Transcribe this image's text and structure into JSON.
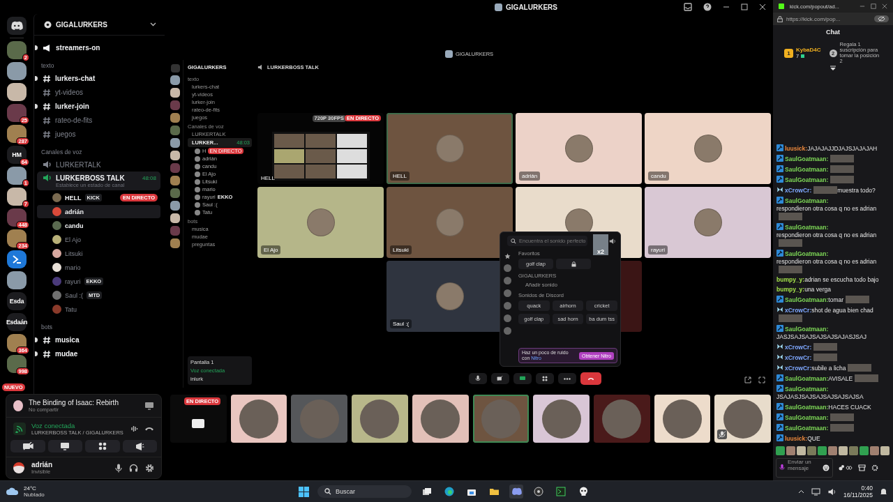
{
  "titlebar": {
    "title": "GIGALURKERS"
  },
  "servers": [
    {
      "kind": "image",
      "badge": "2"
    },
    {
      "kind": "image"
    },
    {
      "kind": "image"
    },
    {
      "kind": "image",
      "badge": "25"
    },
    {
      "kind": "image",
      "badge": "287"
    },
    {
      "kind": "text",
      "label": "HM",
      "badge": "64"
    },
    {
      "kind": "image",
      "badge": "1"
    },
    {
      "kind": "image",
      "badge": "7"
    },
    {
      "kind": "image",
      "badge": "448"
    },
    {
      "kind": "image",
      "badge": "234"
    },
    {
      "kind": "app"
    },
    {
      "kind": "image"
    },
    {
      "kind": "text",
      "label": "Esda"
    },
    {
      "kind": "text",
      "label": "Esdaán"
    },
    {
      "kind": "image",
      "badge": "364"
    },
    {
      "kind": "image",
      "badge": "998"
    }
  ],
  "new_pill": "NUEVO",
  "sidebar": {
    "title": "GIGALURKERS",
    "top_channel": {
      "name": "streamers-on",
      "unread": true
    },
    "text_category": {
      "name": "texto",
      "channels": [
        {
          "name": "lurkers-chat",
          "unread": true
        },
        {
          "name": "yt-videos",
          "unread": false
        },
        {
          "name": "lurker-join",
          "unread": true
        },
        {
          "name": "rateo-de-fits",
          "unread": false
        },
        {
          "name": "juegos",
          "unread": false
        }
      ]
    },
    "voice_category": {
      "name": "Canales de voz",
      "channels": [
        {
          "name": "LURKERTALK",
          "connected": false
        },
        {
          "name": "LURKERBOSS TALK",
          "connected": true,
          "timer": "48:08",
          "status": "Establece un estado de canal",
          "members": [
            {
              "name": "HELL",
              "tag": "KICK",
              "live": "EN DIRECTO",
              "bright": true,
              "hovered": false,
              "color": "#7a6a50"
            },
            {
              "name": "adrián",
              "bright": true,
              "hovered": true,
              "color": "#d94a3a"
            },
            {
              "name": "candu",
              "bright": true,
              "hovered": false,
              "color": "#5a6a50"
            },
            {
              "name": "El Ajo",
              "bright": false,
              "hovered": false,
              "color": "#b8b078"
            },
            {
              "name": "Litsuki",
              "bright": false,
              "hovered": false,
              "color": "#d8a8a0"
            },
            {
              "name": "mario",
              "bright": false,
              "hovered": false,
              "color": "#e8e0d8"
            },
            {
              "name": "rayuri",
              "tag": "EKKO",
              "bright": false,
              "hovered": false,
              "color": "#4a3a7a"
            },
            {
              "name": "Saul :(",
              "tag": "MTD",
              "bright": false,
              "hovered": false,
              "color": "#707070"
            },
            {
              "name": "Tatu",
              "bright": false,
              "hovered": false,
              "color": "#8a3a2a"
            }
          ]
        }
      ]
    },
    "bots_category": {
      "name": "bots",
      "channels": [
        {
          "name": "musica",
          "unread": true
        },
        {
          "name": "mudae",
          "unread": true
        }
      ]
    }
  },
  "panel": {
    "activity": {
      "title": "The Binding of Isaac: Rebirth",
      "subtitle": "No compartir"
    },
    "voice": {
      "status": "Voz conectada",
      "channel": "LURKERBOSS TALK / GIGALURKERS"
    },
    "user": {
      "name": "adrián",
      "status": "Invisible"
    }
  },
  "stream": {
    "title": "GIGALURKERS",
    "channel": "LURKERBOSS TALK",
    "inner_sidebar": {
      "title": "GIGALURKERS",
      "category": "texto",
      "channels": [
        "lurkers-chat",
        "yt-videos",
        "lurker-join",
        "rateo-de-fits",
        "juegos"
      ],
      "voice_category": "Canales de voz",
      "voice_channels": [
        "LURKERTALK",
        "LURKER..."
      ],
      "timer": "48:03",
      "members": [
        {
          "name": "H",
          "live": "EN DIRECTO"
        },
        {
          "name": "adrián"
        },
        {
          "name": "candu"
        },
        {
          "name": "El Ajo"
        },
        {
          "name": "Litsuki"
        },
        {
          "name": "mario"
        },
        {
          "name": "rayuri",
          "tag": "EKKO"
        },
        {
          "name": "Saul :("
        },
        {
          "name": "Tatu"
        }
      ],
      "bots_category": "bots",
      "bots_channels": [
        "musica",
        "mudae",
        "preguntas"
      ],
      "screen": "Pantalla 1",
      "voice_status": "Voz conectada",
      "user": "inlurk"
    },
    "tiles": [
      {
        "kind": "stream",
        "name": "HELL",
        "quality": "720P 30FPS",
        "live": "EN DIRECTO"
      },
      {
        "kind": "user",
        "name": "HELL",
        "color": "#6e5440",
        "speaking": true
      },
      {
        "kind": "user",
        "name": "adrián",
        "color": "#ecd2c8",
        "speaking": false
      },
      {
        "kind": "user",
        "name": "candu",
        "color": "#eed5c6",
        "speaking": false
      },
      {
        "kind": "user",
        "name": "El Ajo",
        "color": "#b5b689",
        "speaking": false
      },
      {
        "kind": "user",
        "name": "Litsuki",
        "color": "#6e5440",
        "speaking": false
      },
      {
        "kind": "user",
        "color": "#e9dccb",
        "speaking": false
      },
      {
        "kind": "user",
        "name": "rayuri",
        "color": "#d9c8d4",
        "speaking": false
      },
      {
        "kind": "empty"
      },
      {
        "kind": "user",
        "name": "Saul :(",
        "color": "#2f343f",
        "speaking": false
      },
      {
        "kind": "user",
        "color": "#3b1515",
        "speaking": false
      },
      {
        "kind": "empty"
      }
    ],
    "soundboard": {
      "placeholder": "Encuentra el sonido perfecto",
      "sticker_count": "x2",
      "favorites": {
        "title": "Favoritos",
        "sounds": [
          {
            "name": "golf clap",
            "locked": false
          },
          {
            "locked": true
          }
        ]
      },
      "server": {
        "title": "GIGALURKERS",
        "add": "Añadir sonido"
      },
      "discord": {
        "title": "Sonidos de Discord",
        "sounds": [
          {
            "name": "quack",
            "locked": false
          },
          {
            "name": "airhorn",
            "locked": false
          },
          {
            "name": "cricket",
            "locked": false
          },
          {
            "name": "golf clap",
            "locked": false
          },
          {
            "name": "sad horn",
            "locked": false
          },
          {
            "name": "ba dum tss",
            "locked": false
          }
        ]
      },
      "promo": "Haz un poco de ruido con",
      "promo_link": "Nitro",
      "button": "Obtener Nitro"
    }
  },
  "strip": [
    {
      "kind": "stream",
      "live": "EN DIRECTO"
    },
    {
      "kind": "user",
      "color": "#e9c6c0",
      "speaking": false,
      "muted": false
    },
    {
      "kind": "user",
      "color": "#55575a",
      "speaking": false,
      "muted": false
    },
    {
      "kind": "user",
      "color": "#b8b78a",
      "speaking": false,
      "muted": false
    },
    {
      "kind": "user",
      "color": "#e2c0b8",
      "speaking": false,
      "muted": false
    },
    {
      "kind": "user",
      "color": "#6e5440",
      "speaking": true,
      "muted": false
    },
    {
      "kind": "user",
      "color": "#d9c6d6",
      "speaking": false,
      "muted": false
    },
    {
      "kind": "user",
      "color": "#4a1a1a",
      "speaking": false,
      "muted": false
    },
    {
      "kind": "user",
      "color": "#eddccb",
      "speaking": false,
      "muted": false
    },
    {
      "kind": "user",
      "color": "#e8dccb",
      "speaking": false,
      "muted": true
    }
  ],
  "browser": {
    "tab": "kick.com/popout/ad...",
    "url": "https://kick.com/pop...",
    "title": "Chat",
    "top_gifter": {
      "rank": "1",
      "name": "KybaD4C",
      "count": "7",
      "promo_rank": "2",
      "promo": "Regala 1 suscripción para tomar la posición 2"
    },
    "messages": [
      {
        "kind": "pick",
        "user": "luusick:",
        "color": "#f08a3c",
        "parts": [
          {
            "kind": "text",
            "text": "JAJAJAJJDJAJSJAJAJAH"
          }
        ]
      },
      {
        "kind": "pick",
        "user": "SaulGoatmaan:",
        "color": "#7ed957",
        "parts": [
          {
            "kind": "image"
          }
        ]
      },
      {
        "kind": "pick",
        "user": "SaulGoatmaan:",
        "color": "#7ed957",
        "parts": [
          {
            "kind": "image"
          }
        ]
      },
      {
        "kind": "pick",
        "user": "SaulGoatmaan:",
        "color": "#7ed957",
        "parts": [
          {
            "kind": "image"
          }
        ]
      },
      {
        "kind": "wings",
        "user": "xCrowCr:",
        "color": "#7fa8ff",
        "parts": [
          {
            "kind": "image"
          },
          {
            "kind": "text",
            "text": "muestra todo?"
          }
        ]
      },
      {
        "kind": "pick",
        "user": "SaulGoatmaan:",
        "color": "#7ed957",
        "parts": [
          {
            "kind": "text",
            "text": "respondieron otra cosa q no es adrian"
          },
          {
            "kind": "image"
          }
        ]
      },
      {
        "kind": "pick",
        "user": "SaulGoatmaan:",
        "color": "#7ed957",
        "parts": [
          {
            "kind": "text",
            "text": "respondieron otra cosa q no es adrian"
          },
          {
            "kind": "image"
          }
        ]
      },
      {
        "kind": "pick",
        "user": "SaulGoatmaan:",
        "color": "#7ed957",
        "parts": [
          {
            "kind": "text",
            "text": "respondieron otra cosa q no es adrian"
          },
          {
            "kind": "image"
          }
        ]
      },
      {
        "kind": "plain",
        "user": "bumpy_y:",
        "color": "#a4e24a",
        "parts": [
          {
            "kind": "text",
            "text": "adrian se escucha todo bajo"
          }
        ]
      },
      {
        "kind": "plain",
        "user": "bumpy_y:",
        "color": "#a4e24a",
        "parts": [
          {
            "kind": "text",
            "text": "una verga"
          }
        ]
      },
      {
        "kind": "pick",
        "user": "SaulGoatmaan:",
        "color": "#7ed957",
        "parts": [
          {
            "kind": "text",
            "text": "tomar"
          },
          {
            "kind": "image"
          }
        ]
      },
      {
        "kind": "wings",
        "user": "xCrowCr:",
        "color": "#7fa8ff",
        "parts": [
          {
            "kind": "text",
            "text": "shot de agua bien chad"
          },
          {
            "kind": "image"
          }
        ]
      },
      {
        "kind": "pick",
        "user": "SaulGoatmaan:",
        "color": "#7ed957",
        "parts": [
          {
            "kind": "text",
            "text": "JASJSAJSAJSAJSAJSAJASJSAJ"
          }
        ]
      },
      {
        "kind": "wings",
        "user": "xCrowCr:",
        "color": "#7fa8ff",
        "parts": [
          {
            "kind": "image"
          }
        ]
      },
      {
        "kind": "wings",
        "user": "xCrowCr:",
        "color": "#7fa8ff",
        "parts": [
          {
            "kind": "image"
          }
        ]
      },
      {
        "kind": "wings",
        "user": "xCrowCr:",
        "color": "#7fa8ff",
        "parts": [
          {
            "kind": "text",
            "text": "subile a licha"
          },
          {
            "kind": "image"
          }
        ]
      },
      {
        "kind": "pick",
        "user": "SaulGoatmaan:",
        "color": "#7ed957",
        "parts": [
          {
            "kind": "text",
            "text": "AVISALE"
          },
          {
            "kind": "image"
          }
        ]
      },
      {
        "kind": "pick",
        "user": "SaulGoatmaan:",
        "color": "#7ed957",
        "parts": [
          {
            "kind": "text",
            "text": "JSAJASJSAJSAJSAJSAJSAJSA"
          }
        ]
      },
      {
        "kind": "pick",
        "user": "SaulGoatmaan:",
        "color": "#7ed957",
        "parts": [
          {
            "kind": "text",
            "text": "HACES CUACK"
          }
        ]
      },
      {
        "kind": "pick",
        "user": "SaulGoatmaan:",
        "color": "#7ed957",
        "parts": [
          {
            "kind": "image"
          }
        ]
      },
      {
        "kind": "pick",
        "user": "SaulGoatmaan:",
        "color": "#7ed957",
        "parts": [
          {
            "kind": "image"
          }
        ]
      },
      {
        "kind": "pick",
        "user": "luusick:",
        "color": "#f08a3c",
        "parts": [
          {
            "kind": "text",
            "text": "QUE"
          }
        ]
      }
    ],
    "input_placeholder": "Enviar un mensaje"
  },
  "taskbar": {
    "temperature": "24°C",
    "weather": "Nublado",
    "search": "Buscar",
    "time": "0:40",
    "date": "16/11/2025"
  }
}
